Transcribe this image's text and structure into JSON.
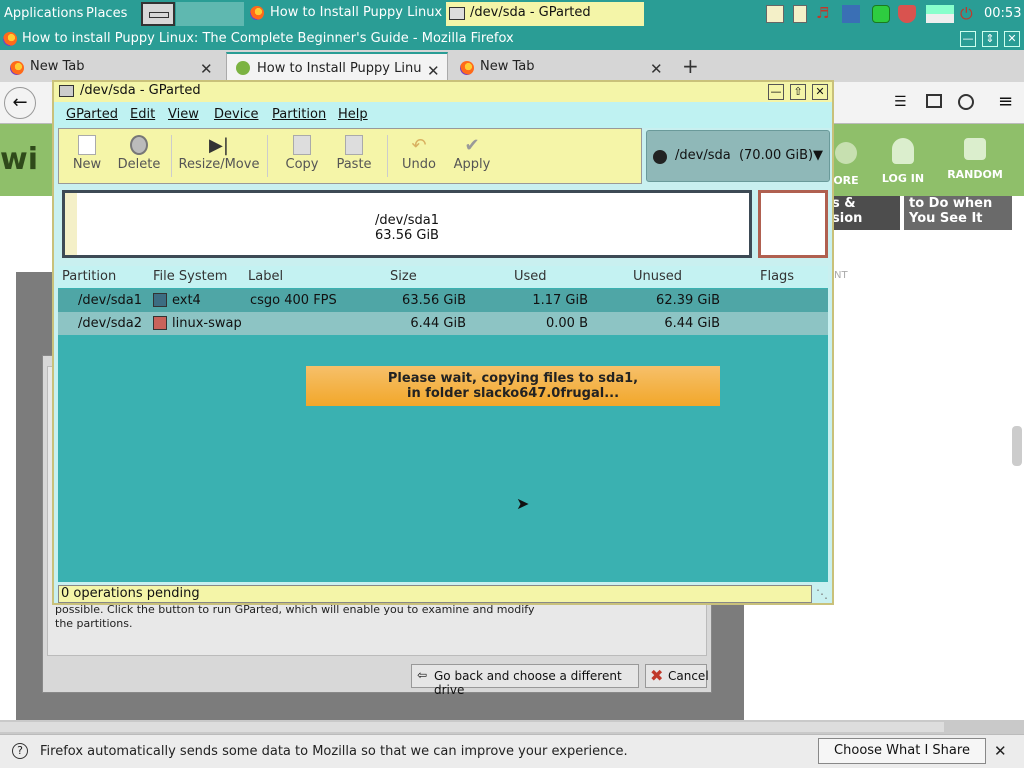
{
  "panel": {
    "applications": "Applications",
    "places": "Places",
    "tasks": [
      "How to Install Puppy Linux:",
      "/dev/sda - GParted"
    ],
    "clock": "00:53"
  },
  "firefox": {
    "window_title": "How to install Puppy Linux: The Complete Beginner's Guide - Mozilla Firefox",
    "tabs": [
      {
        "label": "New Tab"
      },
      {
        "label": "How to Install Puppy Linu"
      },
      {
        "label": "New Tab"
      }
    ],
    "site_nav": [
      "ORE",
      "LOG IN",
      "RANDOM"
    ],
    "site_text": [
      "s &",
      "sion",
      "to Do when",
      "You See It",
      "NT"
    ],
    "installer": {
      "text_line1": "possible. Click the button to run GParted, which will enable you to examine and modify",
      "text_line2": "the partitions.",
      "back_button": "Go back and choose a different drive",
      "cancel_button": "Cancel"
    },
    "notification": {
      "message": "Firefox automatically sends some data to Mozilla so that we can improve your experience.",
      "button": "Choose What I Share"
    }
  },
  "gparted": {
    "title": "/dev/sda - GParted",
    "menu": [
      "GParted",
      "Edit",
      "View",
      "Device",
      "Partition",
      "Help"
    ],
    "toolbar": [
      "New",
      "Delete",
      "Resize/Move",
      "Copy",
      "Paste",
      "Undo",
      "Apply"
    ],
    "device": "/dev/sda  (70.00 GiB)",
    "diskmap": {
      "name": "/dev/sda1",
      "size": "63.56 GiB"
    },
    "columns": [
      "Partition",
      "File System",
      "Label",
      "Size",
      "Used",
      "Unused",
      "Flags"
    ],
    "partitions": [
      {
        "partition": "/dev/sda1",
        "fs": "ext4",
        "fs_color": "#3c6d82",
        "label": "csgo 400 FPS",
        "size": "63.56 GiB",
        "used": "1.17 GiB",
        "unused": "62.39 GiB",
        "flags": ""
      },
      {
        "partition": "/dev/sda2",
        "fs": "linux-swap",
        "fs_color": "#c8625a",
        "label": "",
        "size": "6.44 GiB",
        "used": "0.00 B",
        "unused": "6.44 GiB",
        "flags": ""
      }
    ],
    "wait_line1": "Please wait, copying files to sda1,",
    "wait_line2": "in folder slacko647.0frugal...",
    "status": "0 operations pending"
  }
}
